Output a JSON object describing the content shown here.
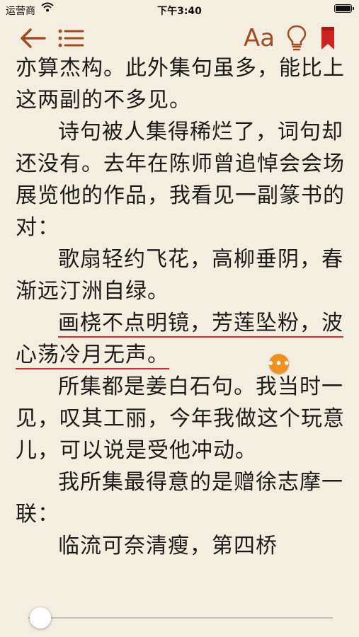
{
  "status_bar": {
    "carrier": "运营商",
    "time": "下午3:40",
    "battery_level": 1.0
  },
  "toolbar": {
    "back_icon": "back-arrow-icon",
    "toc_icon": "list-icon",
    "font_label": "Aa",
    "bulb_icon": "lightbulb-icon",
    "bookmark_icon": "bookmark-icon",
    "accent_color": "#a24a22",
    "bookmark_color": "#cc2222"
  },
  "content": {
    "p1": "亦算杰构。此外集句虽多，能比上这两副的不多见。",
    "p2": "诗句被人集得稀烂了，词句却还没有。去年在陈师曾追悼会会场展览他的作品，我看见一副篆书的对：",
    "p3": "歌扇轻约飞花，高柳垂阴，春渐远汀洲自绿。",
    "p4": "画桡不点明镜，芳莲坠粉，波心荡冷月无声。",
    "p5": "所集都是姜白石句。我当时一见，叹其工丽，今年我做这个玩意儿，可以说是受他冲动。",
    "p6": "我所集最得意的是赠徐志摩一联：",
    "p7": "临流可奈清瘦，第四桥",
    "highlight_color": "#d62b2b",
    "note_badge_color": "#f0901f"
  },
  "progress": {
    "value": 0.04
  }
}
